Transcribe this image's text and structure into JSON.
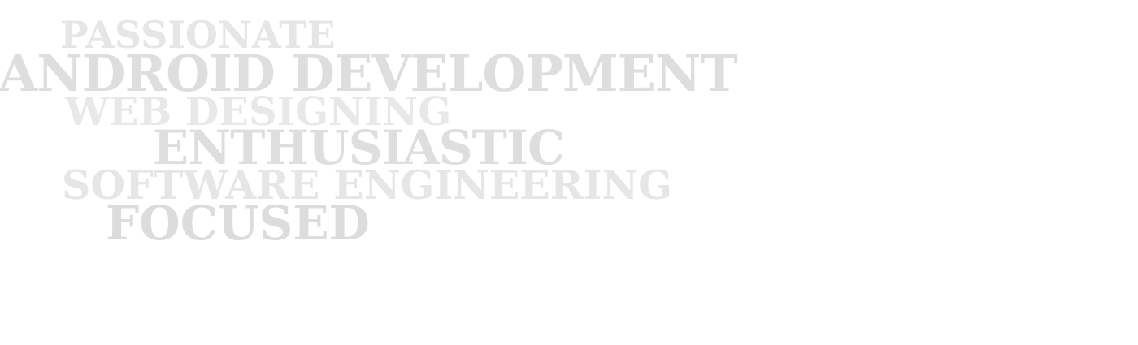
{
  "word_cloud": {
    "words": [
      "PASSIONATE",
      "ANDROID DEVELOPMENT",
      "WEB DESIGNING",
      "ENTHUSIASTIC",
      "SOFTWARE ENGINEERING",
      "FOCUSED"
    ],
    "text_color": "#e2e2e2",
    "background_color": "#ffffff"
  }
}
